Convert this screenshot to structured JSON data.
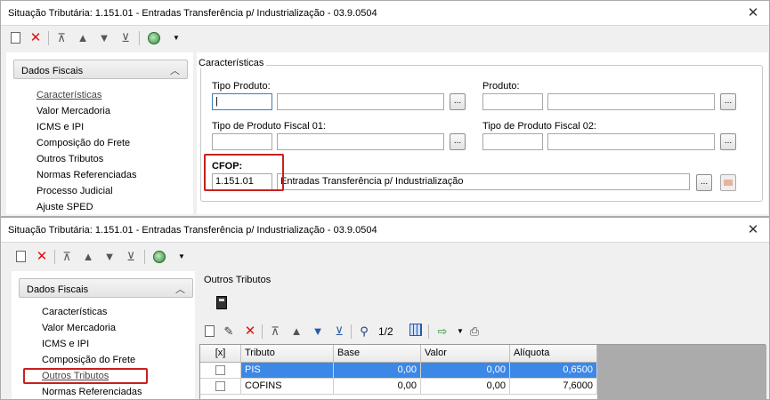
{
  "window_top": {
    "title": "Situação Tributária: 1.151.01 - Entradas Transferência p/ Industrialização - 03.9.0504",
    "sidebar": {
      "header": "Dados Fiscais",
      "items": [
        "Características",
        "Valor Mercadoria",
        "ICMS e IPI",
        "Composição do Frete",
        "Outros Tributos",
        "Normas Referenciadas",
        "Processo Judicial",
        "Ajuste SPED"
      ],
      "active_index": 0
    },
    "main": {
      "group_title": "Características",
      "tipo_produto_label": "Tipo Produto:",
      "tipo_produto_value": "|",
      "tipo_produto_desc": "",
      "produto_label": "Produto:",
      "produto_value": "",
      "produto_desc": "",
      "tipo_fiscal01_label": "Tipo de Produto Fiscal 01:",
      "tipo_fiscal01_value": "",
      "tipo_fiscal01_desc": "",
      "tipo_fiscal02_label": "Tipo de Produto Fiscal 02:",
      "tipo_fiscal02_value": "",
      "tipo_fiscal02_desc": "",
      "cfop_label": "CFOP:",
      "cfop_value": "1.151.01",
      "cfop_desc": "Entradas Transferência p/ Industrialização",
      "ellipsis": "..."
    }
  },
  "window_bottom": {
    "title": "Situação Tributária: 1.151.01 - Entradas Transferência p/ Industrialização - 03.9.0504",
    "sidebar": {
      "header": "Dados Fiscais",
      "items": [
        "Características",
        "Valor Mercadoria",
        "ICMS e IPI",
        "Composição do Frete",
        "Outros Tributos",
        "Normas Referenciadas"
      ],
      "highlighted_index": 4
    },
    "main": {
      "section_title": "Outros Tributos",
      "pager": "1/2",
      "grid": {
        "headers": [
          "[x]",
          "Tributo",
          "Base",
          "Valor",
          "Alíquota"
        ],
        "rows": [
          {
            "tributo": "PIS",
            "base": "0,00",
            "valor": "0,00",
            "aliquota": "0,6500",
            "selected": true
          },
          {
            "tributo": "COFINS",
            "base": "0,00",
            "valor": "0,00",
            "aliquota": "7,6000",
            "selected": false
          }
        ]
      }
    }
  },
  "icons": {
    "close": "×",
    "new": "new-document-icon",
    "delete": "delete-x-icon",
    "first": "⏫",
    "prev": "▲",
    "next": "▼",
    "last": "⏬",
    "chevron_up": "⌃"
  },
  "colors": {
    "highlight_red": "#c9201e",
    "selection_blue": "#3c88e6"
  }
}
